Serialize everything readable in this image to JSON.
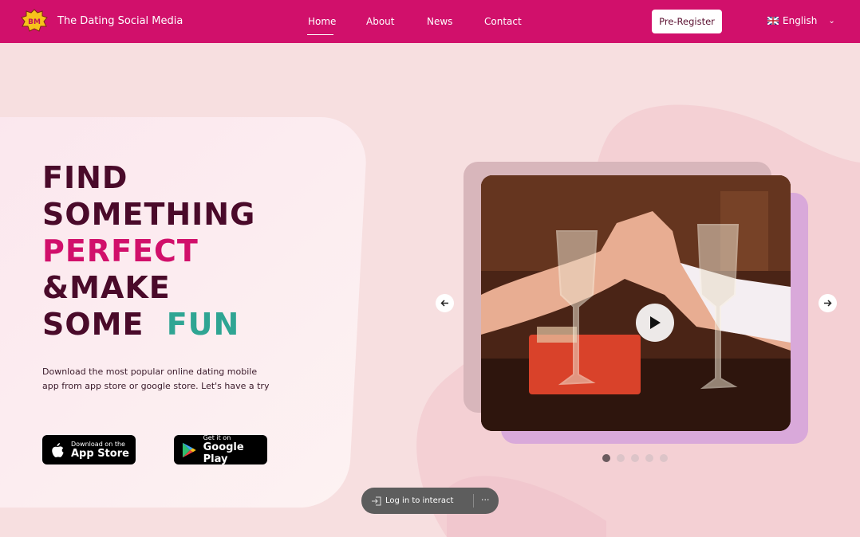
{
  "header": {
    "brand": "The Dating Social Media",
    "logo_text": "BM",
    "nav": [
      {
        "label": "Home",
        "active": true
      },
      {
        "label": "About"
      },
      {
        "label": "News"
      },
      {
        "label": "Contact"
      }
    ],
    "preregister_label": "Pre-Register",
    "language": "English",
    "colors": {
      "bar": "#d1106b"
    }
  },
  "hero": {
    "headline_lines": [
      "FIND",
      "SOMETHING",
      "PERFECT",
      "&MAKE",
      "SOME",
      "FUN"
    ],
    "description": "Download the most popular online dating mobile app from app store or google store. Let's have a try",
    "app_store": {
      "small": "Download on the",
      "big": "App Store"
    },
    "google_play": {
      "small": "Get it on",
      "big": "Google Play"
    }
  },
  "carousel": {
    "slide_count": 5,
    "active_slide": 1
  },
  "overlay": {
    "login_label": "Log in to interact",
    "more_label": "···"
  }
}
